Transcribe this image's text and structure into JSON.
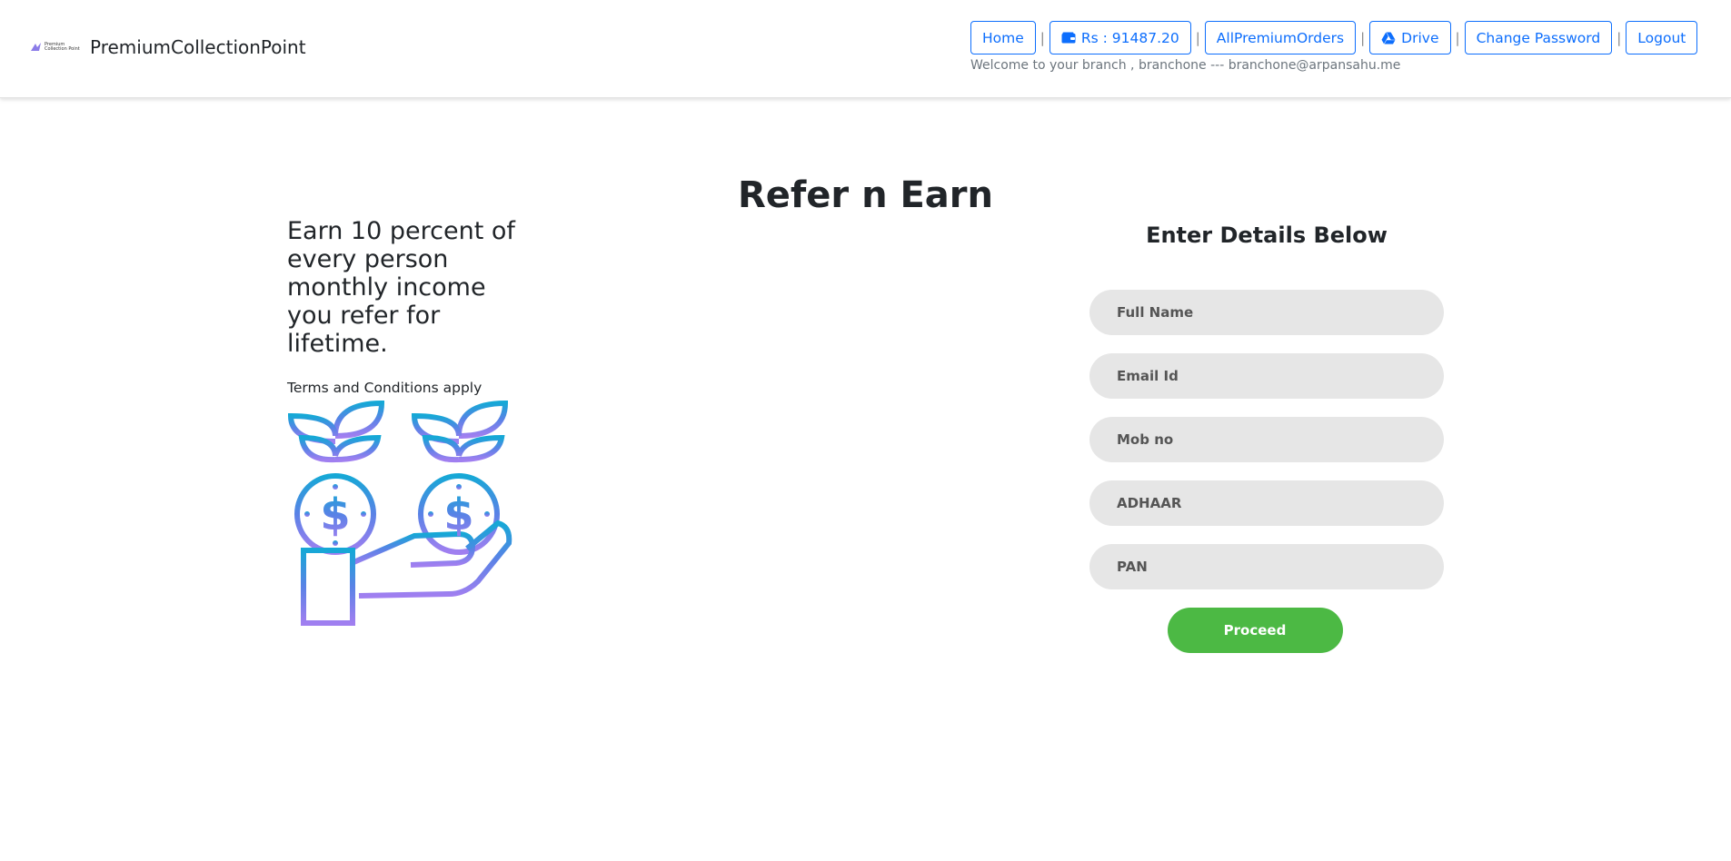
{
  "brand": {
    "logo_text_1": "Premium",
    "logo_text_2": "Collection Point",
    "name": "PremiumCollectionPoint"
  },
  "nav": {
    "home": "Home",
    "balance": "Rs : 91487.20",
    "all_orders": "AllPremiumOrders",
    "drive": "Drive",
    "change_password": "Change Password",
    "logout": "Logout",
    "separator": "|"
  },
  "welcome": "Welcome to your branch , branchone --- branchone@arpansahu.me",
  "main": {
    "title": "Refer n Earn",
    "headline": "Earn 10 percent of every person monthly income you refer for lifetime.",
    "terms": "Terms and Conditions apply"
  },
  "form": {
    "title": "Enter Details Below",
    "full_name_placeholder": "Full Name",
    "email_placeholder": "Email Id",
    "mobile_placeholder": "Mob no",
    "adhaar_placeholder": "ADHAAR",
    "pan_placeholder": "PAN",
    "proceed_label": "Proceed"
  },
  "icons": {
    "wallet": "wallet-icon",
    "drive": "drive-icon",
    "illustration": "money-plant-hand-icon"
  },
  "colors": {
    "link": "#0d6efd",
    "proceed": "#4cb944",
    "field_bg": "#e6e6e6",
    "gradient_top": "#16a8d6",
    "gradient_bottom": "#9b7ff2"
  }
}
